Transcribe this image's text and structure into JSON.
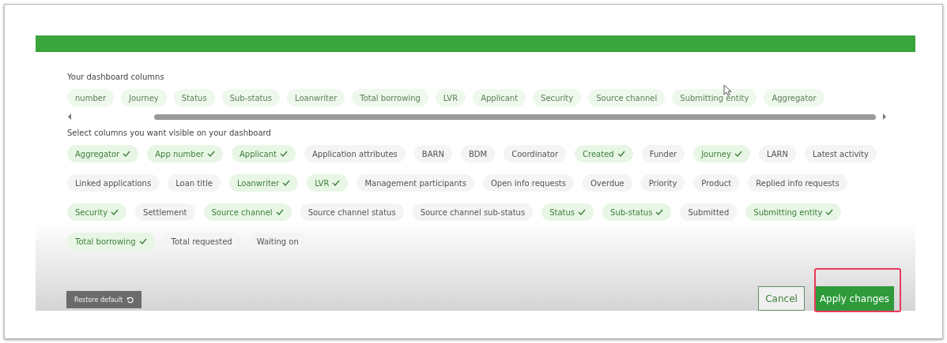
{
  "dashboard_columns": {
    "label": "Your dashboard columns",
    "items": [
      {
        "label": "number"
      },
      {
        "label": "Journey"
      },
      {
        "label": "Status"
      },
      {
        "label": "Sub-status"
      },
      {
        "label": "Loanwriter"
      },
      {
        "label": "Total borrowing"
      },
      {
        "label": "LVR"
      },
      {
        "label": "Applicant"
      },
      {
        "label": "Security"
      },
      {
        "label": "Source channel"
      },
      {
        "label": "Submitting entity"
      },
      {
        "label": "Aggregator"
      }
    ]
  },
  "available_columns": {
    "label": "Select columns you want visible on your dashboard",
    "items": [
      {
        "label": "Aggregator",
        "selected": true
      },
      {
        "label": "App number",
        "selected": true
      },
      {
        "label": "Applicant",
        "selected": true
      },
      {
        "label": "Application attributes",
        "selected": false
      },
      {
        "label": "BARN",
        "selected": false
      },
      {
        "label": "BDM",
        "selected": false
      },
      {
        "label": "Coordinator",
        "selected": false
      },
      {
        "label": "Created",
        "selected": true
      },
      {
        "label": "Funder",
        "selected": false
      },
      {
        "label": "Journey",
        "selected": true
      },
      {
        "label": "LARN",
        "selected": false
      },
      {
        "label": "Latest activity",
        "selected": false
      },
      {
        "label": "Linked applications",
        "selected": false
      },
      {
        "label": "Loan title",
        "selected": false
      },
      {
        "label": "Loanwriter",
        "selected": true
      },
      {
        "label": "LVR",
        "selected": true
      },
      {
        "label": "Management participants",
        "selected": false
      },
      {
        "label": "Open info requests",
        "selected": false
      },
      {
        "label": "Overdue",
        "selected": false
      },
      {
        "label": "Priority",
        "selected": false
      },
      {
        "label": "Product",
        "selected": false
      },
      {
        "label": "Replied info requests",
        "selected": false
      },
      {
        "label": "Security",
        "selected": true
      },
      {
        "label": "Settlement",
        "selected": false
      },
      {
        "label": "Source channel",
        "selected": true
      },
      {
        "label": "Source channel status",
        "selected": false
      },
      {
        "label": "Source channel sub-status",
        "selected": false
      },
      {
        "label": "Status",
        "selected": true
      },
      {
        "label": "Sub-status",
        "selected": true
      },
      {
        "label": "Submitted",
        "selected": false
      },
      {
        "label": "Submitting entity",
        "selected": true
      },
      {
        "label": "Total borrowing",
        "selected": true
      },
      {
        "label": "Total requested",
        "selected": false
      },
      {
        "label": "Waiting on",
        "selected": false
      }
    ]
  },
  "footer": {
    "restore_button": "Restore default",
    "cancel_button": "Cancel",
    "apply_button": "Apply changes"
  }
}
